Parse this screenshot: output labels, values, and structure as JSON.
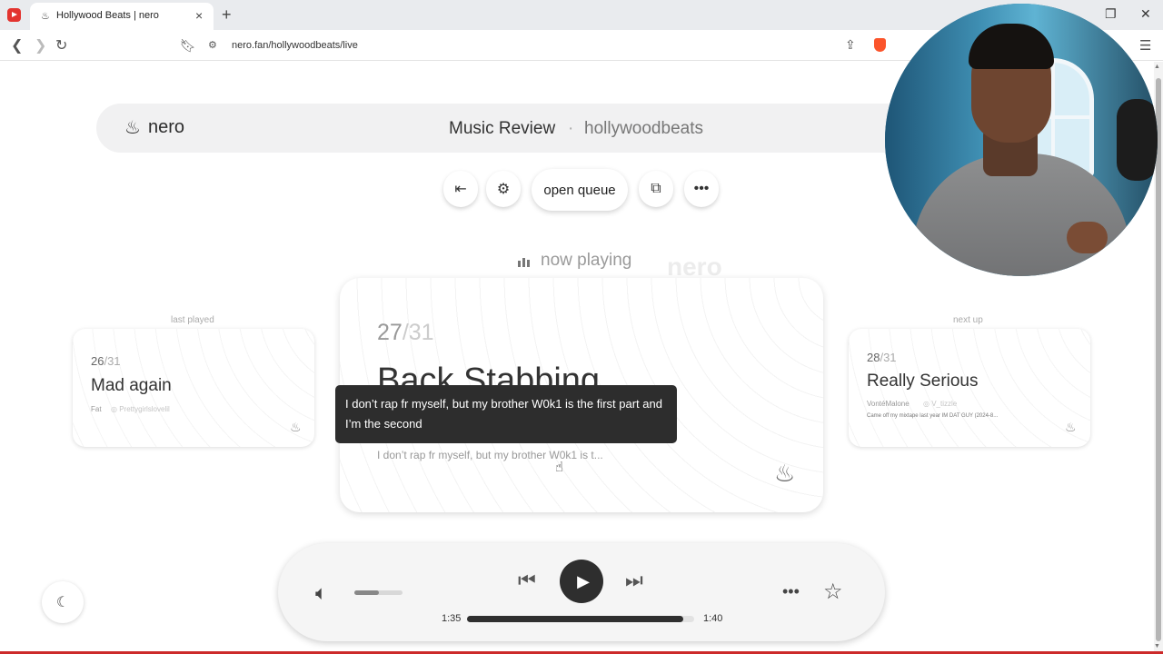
{
  "browser": {
    "tab_title": "Hollywood Beats | nero",
    "tab_favicon": "nero-flame-icon",
    "url": "nero.fan/hollywoodbeats/live",
    "new_tab": "+",
    "tab_close": "×"
  },
  "header": {
    "logo_text": "nero",
    "title": "Music Review",
    "separator": "·",
    "subtitle": "hollywoodbeats"
  },
  "controls": {
    "exit_icon": "exit-icon",
    "settings_icon": "gear-icon",
    "open_queue_label": "open queue",
    "popout_icon": "popout-icon",
    "more_icon": "more-icon"
  },
  "now_playing": {
    "label": "now playing",
    "watermark": "nero"
  },
  "last_played": {
    "label": "last played",
    "number": "26",
    "total": "/31",
    "title": "Mad again",
    "artist": "Fat",
    "handle": "Prettygirlslovelil"
  },
  "current": {
    "number": "27",
    "total": "/31",
    "title": "Back Stabbing",
    "description": "I don’t rap fr myself, but my brother W0k1 is t...",
    "tooltip": "I don’t rap fr myself, but my brother W0k1 is the first part and I’m the second"
  },
  "next_up": {
    "label": "next up",
    "number": "28",
    "total": "/31",
    "title": "Really Serious",
    "artist": "VontéMalone",
    "handle": "V_tizzle",
    "description": "Came off my mixtape last year IM DAT GUY (2024-8..."
  },
  "player": {
    "current_time": "1:35",
    "total_time": "1:40",
    "progress": 0.95,
    "volume": 0.5,
    "more_label": "•••",
    "favorite_icon": "star-icon"
  },
  "colors": {
    "accent_dark": "#2e2e2e",
    "header_bg": "#f1f1f2",
    "brave_orange": "#fb542b"
  }
}
